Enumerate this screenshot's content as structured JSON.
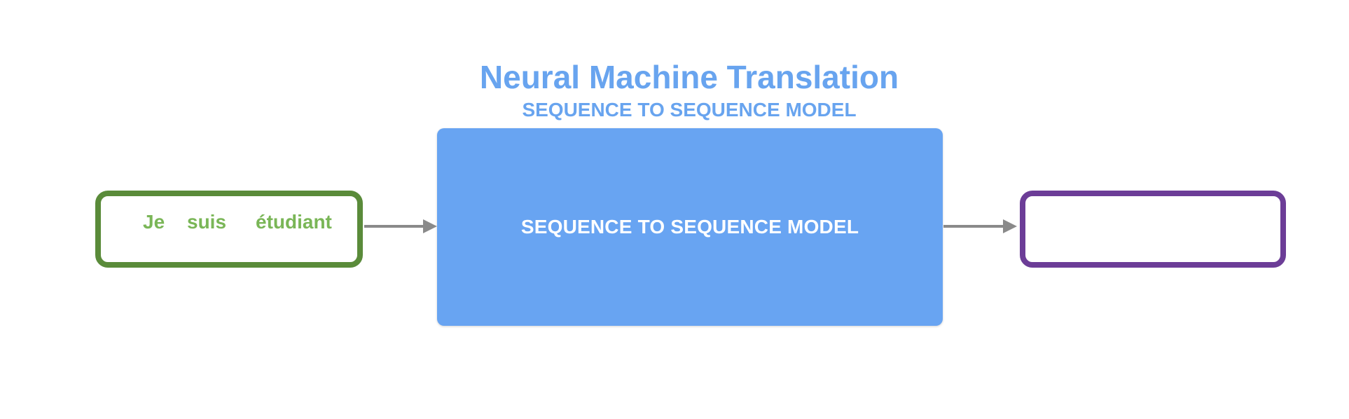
{
  "diagram": {
    "title": "Neural Machine Translation",
    "subtitle": "SEQUENCE TO SEQUENCE MODEL",
    "model_label": "SEQUENCE TO SEQUENCE MODEL",
    "input_words": [
      "Je",
      "suis",
      "étudiant"
    ],
    "output_words": [],
    "colors": {
      "title": "#68a4ef",
      "model_fill": "#68a4f2",
      "input_border": "#5a8b3a",
      "input_text": "#7ab657",
      "output_border": "#6c3d97",
      "arrow": "#8a8a8a"
    }
  }
}
